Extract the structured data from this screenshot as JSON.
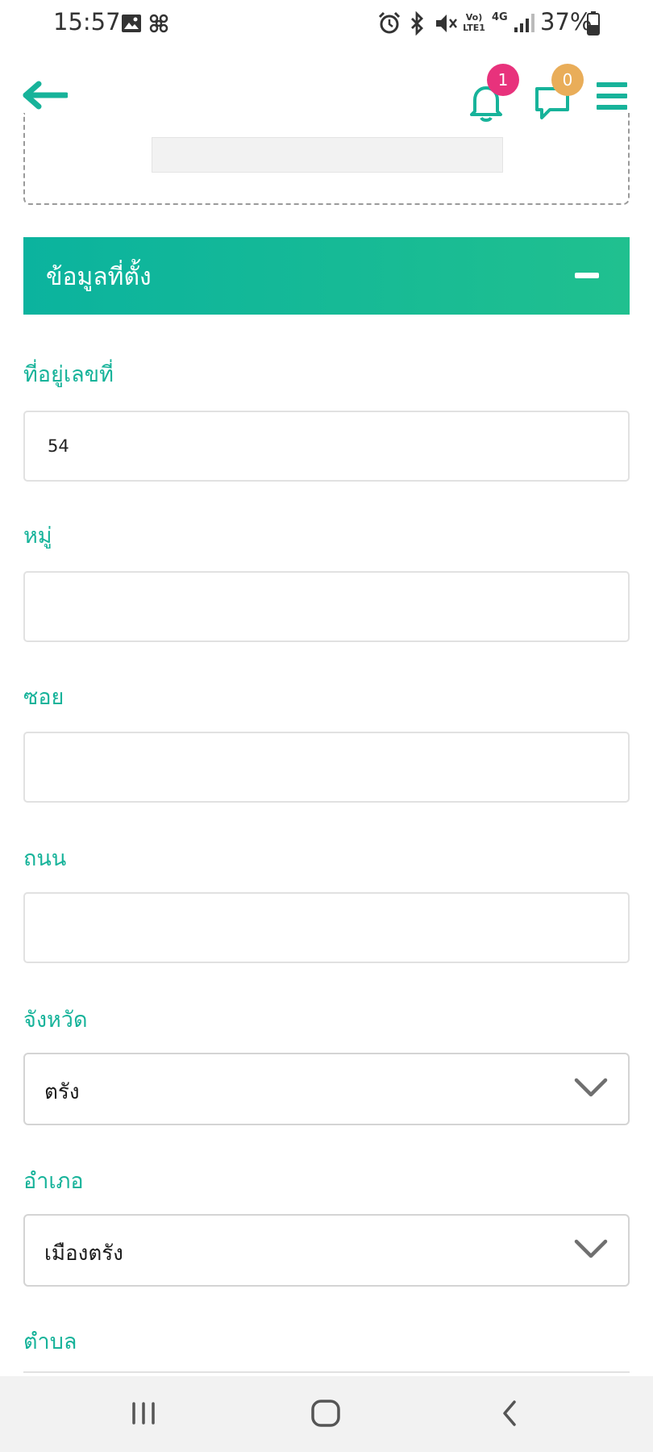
{
  "status_bar": {
    "time": "15:57",
    "battery": "37%",
    "network_top": "Vo)",
    "network_bottom": "LTE1",
    "network_type": "4G",
    "icons": [
      "image-icon",
      "pinwheel-icon",
      "alarm-icon",
      "bluetooth-icon",
      "mute-icon",
      "signal-icon",
      "battery-icon"
    ]
  },
  "header": {
    "notifications_count": "1",
    "messages_count": "0",
    "accent_color": "#17b39a",
    "notif_badge_color": "#e8327c",
    "msg_badge_color": "#e9ad59"
  },
  "section": {
    "title": "ข้อมูลที่ตั้ง"
  },
  "fields": {
    "house_no": {
      "label": "ที่อยู่เลขที่",
      "value": "54"
    },
    "moo": {
      "label": "หมู่",
      "value": ""
    },
    "soi": {
      "label": "ซอย",
      "value": ""
    },
    "road": {
      "label": "ถนน",
      "value": ""
    },
    "province": {
      "label": "จังหวัด",
      "value": "ตรัง"
    },
    "district": {
      "label": "อำเภอ",
      "value": "เมืองตรัง"
    },
    "subdistrict": {
      "label": "ตำบล"
    }
  },
  "nav_bar": {
    "icons": [
      "recent-apps-icon",
      "home-icon",
      "back-icon"
    ]
  }
}
